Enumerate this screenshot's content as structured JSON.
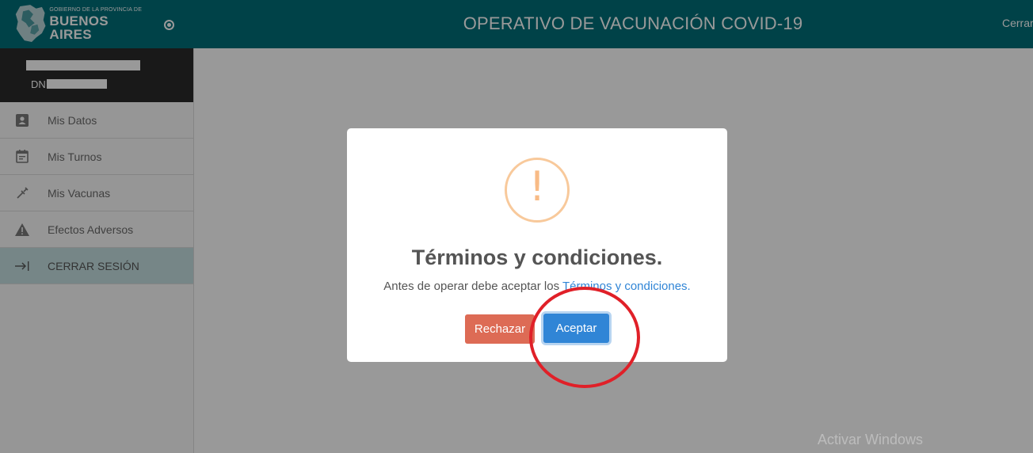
{
  "header": {
    "logo_line1": "GOBIERNO DE LA PROVINCIA DE",
    "logo_line2": "BUENOS AIRES",
    "title": "OPERATIVO DE VACUNACIÓN COVID-19",
    "logout": "Cerrar s"
  },
  "user": {
    "dni_label": "DNI"
  },
  "sidebar": {
    "items": [
      {
        "label": "Mis Datos",
        "icon": "contact-card-icon"
      },
      {
        "label": "Mis Turnos",
        "icon": "calendar-icon"
      },
      {
        "label": "Mis Vacunas",
        "icon": "syringe-icon"
      },
      {
        "label": "Efectos Adversos",
        "icon": "warning-icon"
      },
      {
        "label": "CERRAR SESIÓN",
        "icon": "logout-arrow-icon"
      }
    ]
  },
  "modal": {
    "icon_glyph": "!",
    "title": "Términos y condiciones.",
    "text_prefix": "Antes de operar debe aceptar los ",
    "link_text": "Términos y condiciones.",
    "reject_label": "Rechazar",
    "accept_label": "Aceptar"
  },
  "colors": {
    "header": "#006f79",
    "reject": "#dd6b55",
    "accept": "#3085d6",
    "warning": "#f8bb86",
    "annotation": "#e02028"
  },
  "watermark": "Activar Windows"
}
